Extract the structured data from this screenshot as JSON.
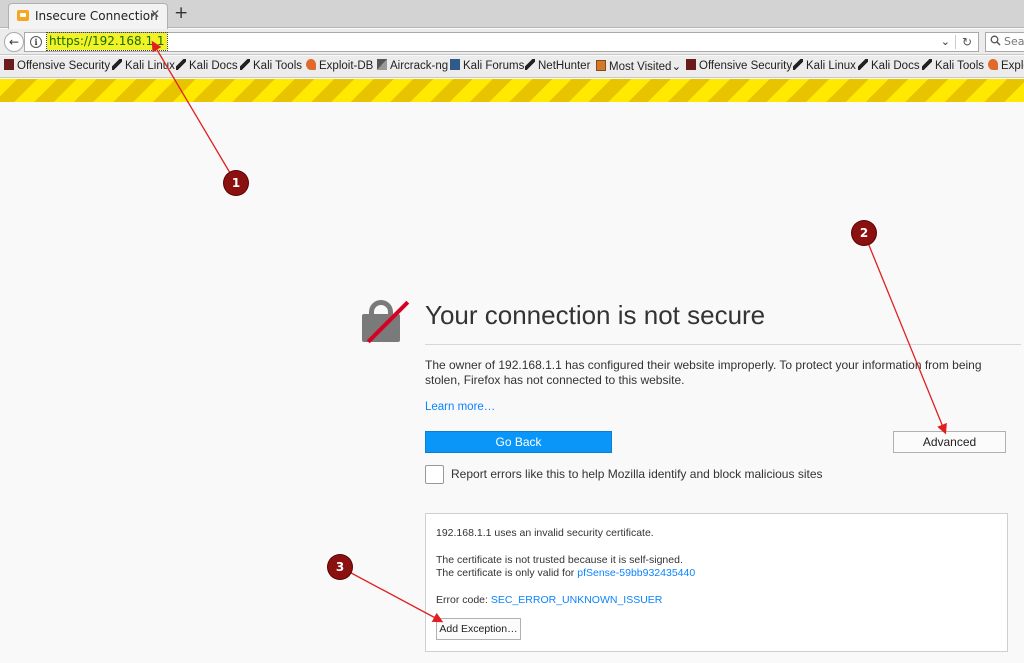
{
  "browser": {
    "tab": {
      "title": "Insecure Connection",
      "close_glyph": "✕",
      "icon": "warning-favicon"
    },
    "new_tab_glyph": "+",
    "back_glyph": "←",
    "url": "https://192.168.1.1",
    "info_glyph": "i",
    "dropdown_glyph": "⌄",
    "reload_glyph": "↻",
    "search": {
      "placeholder": "Sear",
      "icon": "magnifier-icon"
    }
  },
  "bookmarks": [
    {
      "label": "Offensive Security",
      "icon": "ico-os"
    },
    {
      "label": "Kali Linux",
      "icon": "ico-dragon"
    },
    {
      "label": "Kali Docs",
      "icon": "ico-dragon"
    },
    {
      "label": "Kali Tools",
      "icon": "ico-dragon"
    },
    {
      "label": "Exploit-DB",
      "icon": "ico-edb"
    },
    {
      "label": "Aircrack-ng",
      "icon": "ico-air"
    },
    {
      "label": "Kali Forums",
      "icon": "ico-forum"
    },
    {
      "label": "NetHunter",
      "icon": "ico-dragon"
    },
    {
      "label": "Most Visited",
      "icon": "ico-mv",
      "dropdown": "⌄"
    },
    {
      "label": "Offensive Security",
      "icon": "ico-os"
    },
    {
      "label": "Kali Linux",
      "icon": "ico-dragon"
    },
    {
      "label": "Kali Docs",
      "icon": "ico-dragon"
    },
    {
      "label": "Kali Tools",
      "icon": "ico-dragon"
    },
    {
      "label": "Exploi",
      "icon": "ico-edb"
    }
  ],
  "error_page": {
    "title": "Your connection is not secure",
    "description": "The owner of 192.168.1.1 has configured their website improperly. To protect your information from being stolen, Firefox has not connected to this website.",
    "learn_more": "Learn more…",
    "go_back": "Go Back",
    "advanced": "Advanced",
    "report_label": "Report errors like this to help Mozilla identify and block malicious sites",
    "report_checked": false,
    "colors": {
      "accent": "#0996f8",
      "link": "#0a84ff",
      "hazard_yellow": "#ffe900",
      "slash_red": "#d70022"
    }
  },
  "advanced_panel": {
    "line1": "192.168.1.1 uses an invalid security certificate.",
    "line2": "The certificate is not trusted because it is self-signed.",
    "line3_prefix": "The certificate is only valid for ",
    "line3_link": "pfSense-59bb932435440",
    "error_prefix": "Error code: ",
    "error_code": "SEC_ERROR_UNKNOWN_ISSUER",
    "add_exception": "Add Exception…"
  },
  "annotations": [
    {
      "label": "1"
    },
    {
      "label": "2"
    },
    {
      "label": "3"
    }
  ]
}
